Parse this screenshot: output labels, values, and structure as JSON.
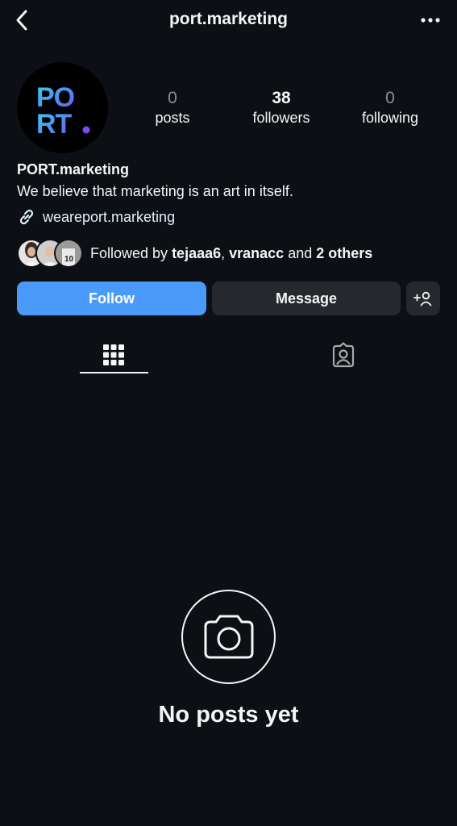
{
  "header": {
    "title": "port.marketing",
    "back_icon": "chevron-left-icon",
    "more_icon": "more-horizontal-icon"
  },
  "profile": {
    "avatar_text": "PORT.",
    "stats": [
      {
        "value": "0",
        "label": "posts"
      },
      {
        "value": "38",
        "label": "followers"
      },
      {
        "value": "0",
        "label": "following"
      }
    ],
    "display_name": "PORT.marketing",
    "bio": "We believe that marketing is an art in itself.",
    "link": "weareport.marketing",
    "followed_by": {
      "prefix": "Followed by ",
      "user1": "tejaaa6",
      "separator": ", ",
      "user2": "vranacc",
      "and": " and ",
      "others": "2 others"
    }
  },
  "actions": {
    "follow_label": "Follow",
    "message_label": "Message"
  },
  "tabs": [
    {
      "name": "posts-grid",
      "icon": "grid-icon",
      "active": true
    },
    {
      "name": "tagged",
      "icon": "tagged-user-icon",
      "active": false
    }
  ],
  "empty_state": {
    "text": "No posts yet",
    "icon": "camera-icon"
  },
  "colors": {
    "background": "#0c1014",
    "follow_button": "#4a9bf9",
    "secondary_button": "#25292e",
    "link": "#e0f1ff",
    "muted": "#8e8e8e"
  }
}
